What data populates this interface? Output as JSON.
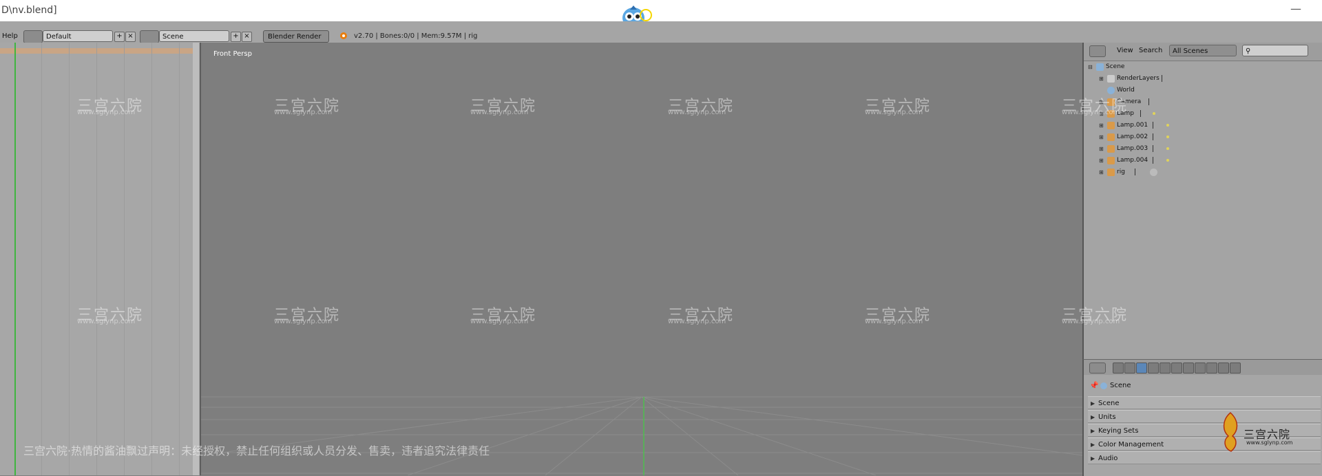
{
  "window": {
    "title": "D\\nv.blend]"
  },
  "header": {
    "help_label": "Help",
    "layout_value": "Default",
    "scene_value": "Scene",
    "render_engine": "Blender Render",
    "stats": "v2.70 | Bones:0/0  | Mem:9.57M | rig"
  },
  "viewport": {
    "label": "Front Persp"
  },
  "outliner": {
    "view_label": "View",
    "search_label": "Search",
    "filter_value": "All Scenes",
    "items": [
      {
        "label": "Scene"
      },
      {
        "label": "RenderLayers"
      },
      {
        "label": "World"
      },
      {
        "label": "Camera"
      },
      {
        "label": "Lamp"
      },
      {
        "label": "Lamp.001"
      },
      {
        "label": "Lamp.002"
      },
      {
        "label": "Lamp.003"
      },
      {
        "label": "Lamp.004"
      },
      {
        "label": "rig"
      }
    ]
  },
  "properties": {
    "context_label": "Scene",
    "panels": [
      {
        "label": "Scene"
      },
      {
        "label": "Units"
      },
      {
        "label": "Keying Sets"
      },
      {
        "label": "Color Management"
      },
      {
        "label": "Audio"
      }
    ]
  },
  "watermark": {
    "notice": "三宫六院·热情的酱油飘过声明：未经授权，禁止任何组织或人员分发、售卖，违者追究法律责任",
    "brand": "三宫六院",
    "url": "www.sglynp.com"
  },
  "colors": {
    "accent_orange": "#c9a585",
    "timeline_green": "#3fb53f",
    "viewport_bg": "#7e7e7e"
  }
}
